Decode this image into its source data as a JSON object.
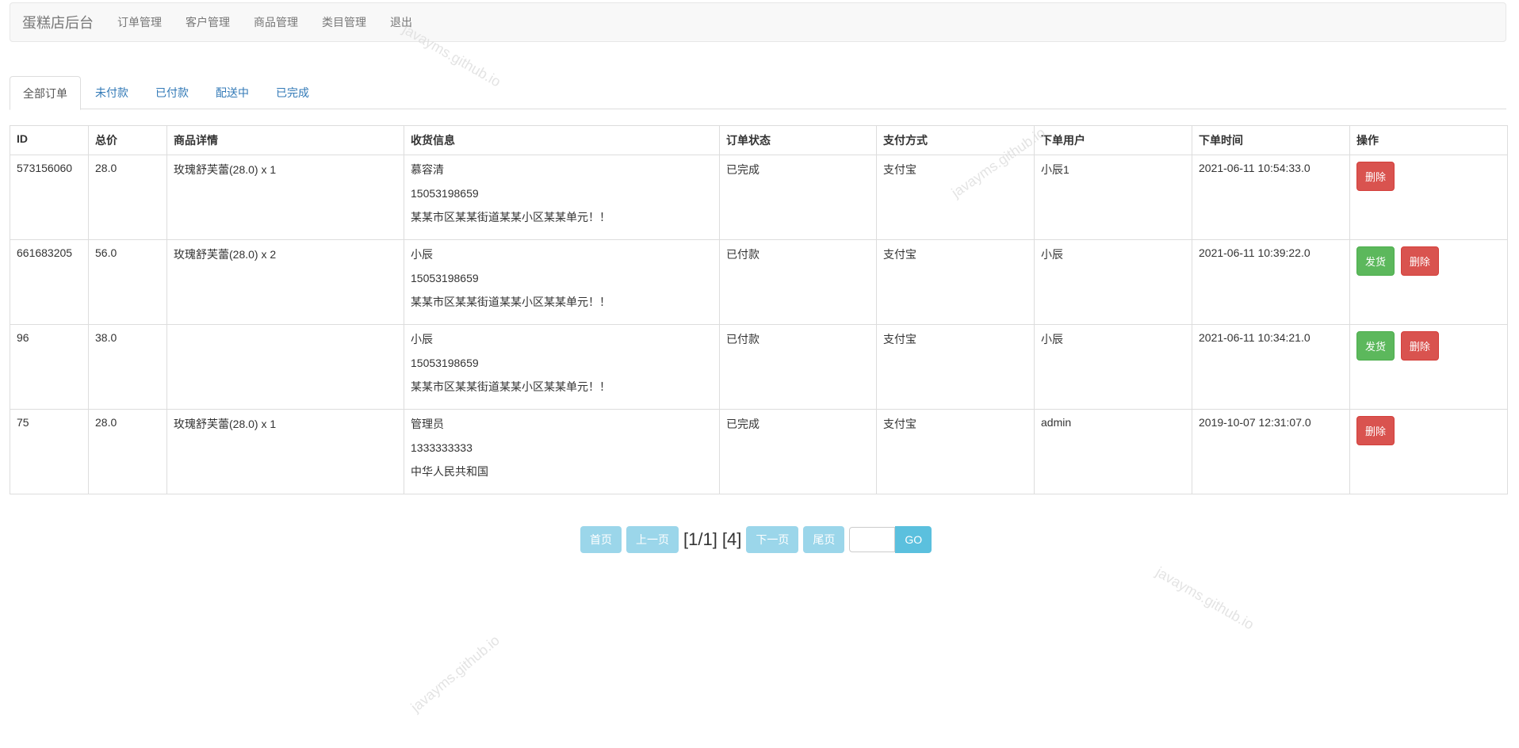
{
  "nav": {
    "brand": "蛋糕店后台",
    "links": [
      "订单管理",
      "客户管理",
      "商品管理",
      "类目管理",
      "退出"
    ]
  },
  "tabs": [
    "全部订单",
    "未付款",
    "已付款",
    "配送中",
    "已完成"
  ],
  "table": {
    "headers": [
      "ID",
      "总价",
      "商品详情",
      "收货信息",
      "订单状态",
      "支付方式",
      "下单用户",
      "下单时间",
      "操作"
    ],
    "rows": [
      {
        "id": "573156060",
        "total": "28.0",
        "detail": "玫瑰舒芙蕾(28.0) x 1",
        "name": "慕容清",
        "phone": "15053198659",
        "address": "某某市区某某街道某某小区某某单元！！",
        "status": "已完成",
        "pay": "支付宝",
        "user": "小辰1",
        "time": "2021-06-11 10:54:33.0",
        "ship": "",
        "delete": "删除"
      },
      {
        "id": "661683205",
        "total": "56.0",
        "detail": "玫瑰舒芙蕾(28.0) x 2",
        "name": "小辰",
        "phone": "15053198659",
        "address": "某某市区某某街道某某小区某某单元！！",
        "status": "已付款",
        "pay": "支付宝",
        "user": "小辰",
        "time": "2021-06-11 10:39:22.0",
        "ship": "发货",
        "delete": "删除"
      },
      {
        "id": "96",
        "total": "38.0",
        "detail": "",
        "name": "小辰",
        "phone": "15053198659",
        "address": "某某市区某某街道某某小区某某单元！！",
        "status": "已付款",
        "pay": "支付宝",
        "user": "小辰",
        "time": "2021-06-11 10:34:21.0",
        "ship": "发货",
        "delete": "删除"
      },
      {
        "id": "75",
        "total": "28.0",
        "detail": "玫瑰舒芙蕾(28.0) x 1",
        "name": "管理员",
        "phone": "1333333333",
        "address": "中华人民共和国",
        "status": "已完成",
        "pay": "支付宝",
        "user": "admin",
        "time": "2019-10-07 12:31:07.0",
        "ship": "",
        "delete": "删除"
      }
    ]
  },
  "pager": {
    "first": "首页",
    "prev": "上一页",
    "info": "[1/1] [4]",
    "next": "下一页",
    "last": "尾页",
    "go": "GO"
  },
  "watermark": "javayms.github.io",
  "colors": {
    "paid": "#ff0000",
    "success": "#5cb85c",
    "danger": "#d9534f",
    "link": "#337ab7"
  }
}
